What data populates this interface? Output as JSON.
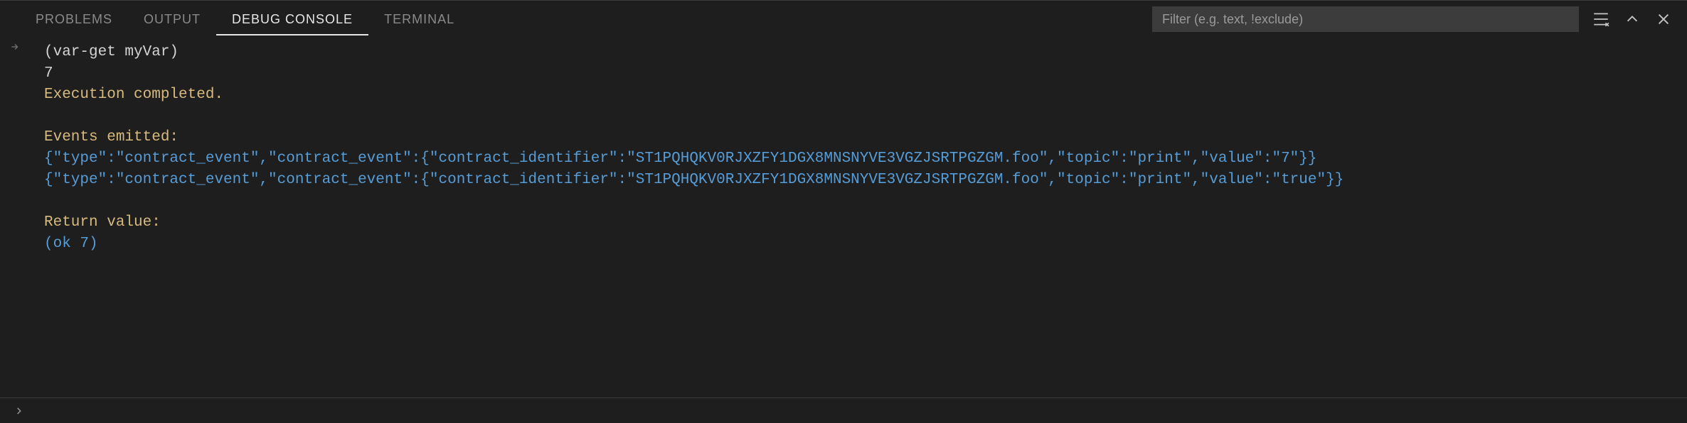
{
  "tabs": {
    "problems": "PROBLEMS",
    "output": "OUTPUT",
    "debug_console": "DEBUG CONSOLE",
    "terminal": "TERMINAL",
    "active": "debug_console"
  },
  "filter": {
    "placeholder": "Filter (e.g. text, !exclude)"
  },
  "console": {
    "input_expr": "(var-get myVar)",
    "result": "7",
    "exec_complete": "Execution completed.",
    "events_header": "Events emitted:",
    "event1": "{\"type\":\"contract_event\",\"contract_event\":{\"contract_identifier\":\"ST1PQHQKV0RJXZFY1DGX8MNSNYVE3VGZJSRTPGZGM.foo\",\"topic\":\"print\",\"value\":\"7\"}}",
    "event2": "{\"type\":\"contract_event\",\"contract_event\":{\"contract_identifier\":\"ST1PQHQKV0RJXZFY1DGX8MNSNYVE3VGZJSRTPGZGM.foo\",\"topic\":\"print\",\"value\":\"true\"}}",
    "return_header": "Return value:",
    "return_value": "(ok 7)"
  }
}
